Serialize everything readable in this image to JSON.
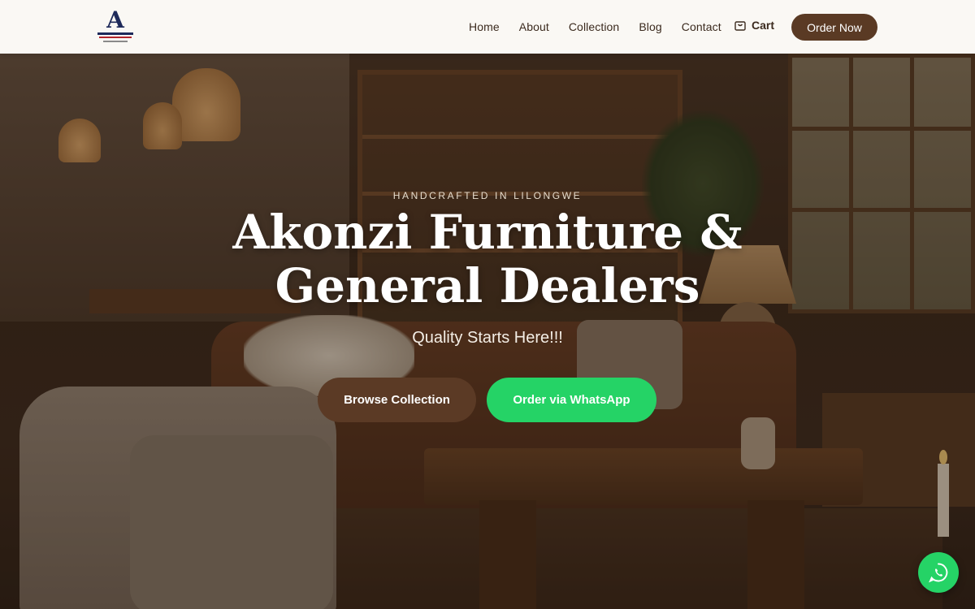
{
  "header": {
    "logo_name": "akonzi-logo",
    "nav": [
      {
        "label": "Home"
      },
      {
        "label": "About"
      },
      {
        "label": "Collection"
      },
      {
        "label": "Blog"
      },
      {
        "label": "Contact"
      }
    ],
    "cart_label": "Cart",
    "cart_icon": "shopping-bag-icon",
    "order_label": "Order Now"
  },
  "hero": {
    "eyebrow": "HANDCRAFTED IN LILONGWE",
    "title_line1": "Akonzi Furniture &",
    "title_line2": "General Dealers",
    "tagline": "Quality Starts Here!!!",
    "browse_label": "Browse Collection",
    "whatsapp_label": "Order via WhatsApp"
  },
  "fab": {
    "icon": "whatsapp-icon"
  },
  "colors": {
    "brand_brown": "#5b3a25",
    "whatsapp_green": "#25d366",
    "header_bg": "#faf8f4",
    "nav_text": "#3b2a1e"
  }
}
